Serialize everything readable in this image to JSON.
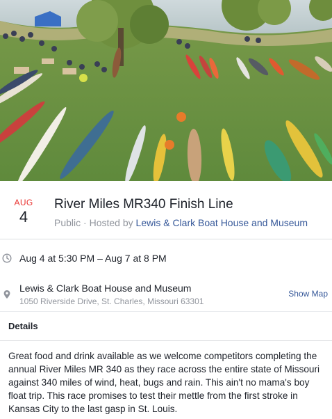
{
  "event": {
    "cover_alt": "Kayaks and canoes lined up on a riverbank lawn",
    "date": {
      "month": "AUG",
      "day": "4"
    },
    "title": "River Miles MR340 Finish Line",
    "visibility": "Public",
    "separator": " · ",
    "hosted_by_label": "Hosted by ",
    "host": "Lewis & Clark Boat House and Museum",
    "time": "Aug 4 at 5:30 PM – Aug 7 at 8 PM",
    "location": {
      "name": "Lewis & Clark Boat House and Museum",
      "address": "1050 Riverside Drive, St. Charles, Missouri 63301",
      "show_map_label": "Show Map"
    },
    "details_label": "Details",
    "details_lines": [
      "Great food and drink available as we welcome competitors completing the",
      "annual River Miles MR 340 as they race across the entire state of Missouri",
      "against 340 miles of wind, heat, bugs and rain. This ain't no mama's boy",
      "float trip. This race promises to test their mettle from the first stroke in",
      "Kansas City to the last gasp in St. Louis."
    ]
  },
  "icons": {
    "time": "clock-icon",
    "location": "map-pin-icon"
  },
  "colors": {
    "date_month": "#e9322f",
    "link": "#365899",
    "muted": "#90949c",
    "text": "#1d2129",
    "divider": "#dddfe2"
  }
}
